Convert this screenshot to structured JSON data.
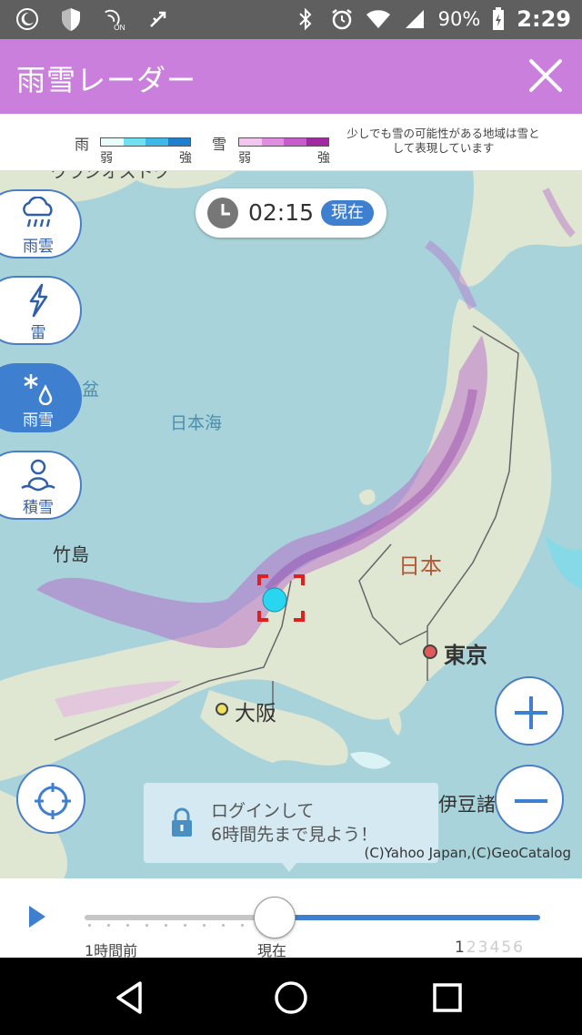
{
  "status_bar": {
    "battery": "90%",
    "time": "2:29",
    "icons": [
      "moon-icon",
      "shield-icon",
      "nfc-on-icon",
      "usb-icon",
      "bluetooth-icon",
      "alarm-icon",
      "wifi-icon",
      "signal-icon",
      "battery-icon"
    ],
    "nfc_label": "ON"
  },
  "header": {
    "title": "雨雪レーダー",
    "close_icon": "close-icon"
  },
  "legend": {
    "rain_label": "雨",
    "snow_label": "雪",
    "weak": "弱",
    "strong": "強",
    "rain_colors": [
      "#e9fbfb",
      "#6fe0f2",
      "#3db8e8",
      "#1e7fcf"
    ],
    "snow_colors": [
      "#f3c6f0",
      "#e08fe0",
      "#c85ccc",
      "#a12aa3"
    ],
    "note": "少しでも雪の可能性がある地域は雪として表現しています"
  },
  "map": {
    "time": "02:15",
    "now_badge": "現在",
    "labels": {
      "sea": "日本海",
      "country": "日本",
      "tokyo": "東京",
      "osaka": "大阪",
      "takeshima": "竹島",
      "izu": "伊豆諸",
      "basin_partial": "盆",
      "top_partial": "ウラジオストク"
    },
    "side_buttons": [
      {
        "label": "雨雲",
        "icon": "rain-cloud-icon"
      },
      {
        "label": "雷",
        "icon": "lightning-icon"
      },
      {
        "label": "雨雪",
        "icon": "snow-rain-icon"
      },
      {
        "label": "積雪",
        "icon": "snowman-icon"
      }
    ],
    "login_text_1": "ログインして",
    "login_text_2": "6時間先まで見よう！",
    "copyright": "(C)Yahoo Japan,(C)GeoCatalog",
    "colors": {
      "sea": "#a9d3da",
      "land": "#dfe7d3",
      "accent": "#3f7fd0",
      "snow": "#b55ac8"
    }
  },
  "timeline": {
    "past_label": "1時間前",
    "now_label": "現在",
    "hours": [
      "1",
      "2",
      "3",
      "4",
      "5",
      "6"
    ]
  },
  "navbar": {
    "icons": [
      "back-icon",
      "home-icon",
      "recents-icon"
    ]
  }
}
